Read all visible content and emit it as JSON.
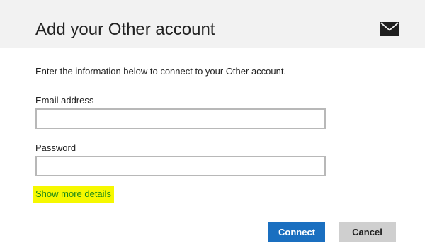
{
  "header": {
    "title": "Add your Other account",
    "icon": "mail-envelope-icon"
  },
  "form": {
    "intro": "Enter the information below to connect to your Other account.",
    "email_label": "Email address",
    "email_value": "",
    "password_label": "Password",
    "password_value": "",
    "details_link": "Show more details"
  },
  "actions": {
    "connect_label": "Connect",
    "cancel_label": "Cancel"
  },
  "colors": {
    "header_bg": "#f2f2f2",
    "accent": "#1a6fc0",
    "link": "#1e8a16",
    "link_highlight": "#f6f800",
    "cancel_bg": "#cfcfcf",
    "field_border": "#b8b8b8"
  }
}
